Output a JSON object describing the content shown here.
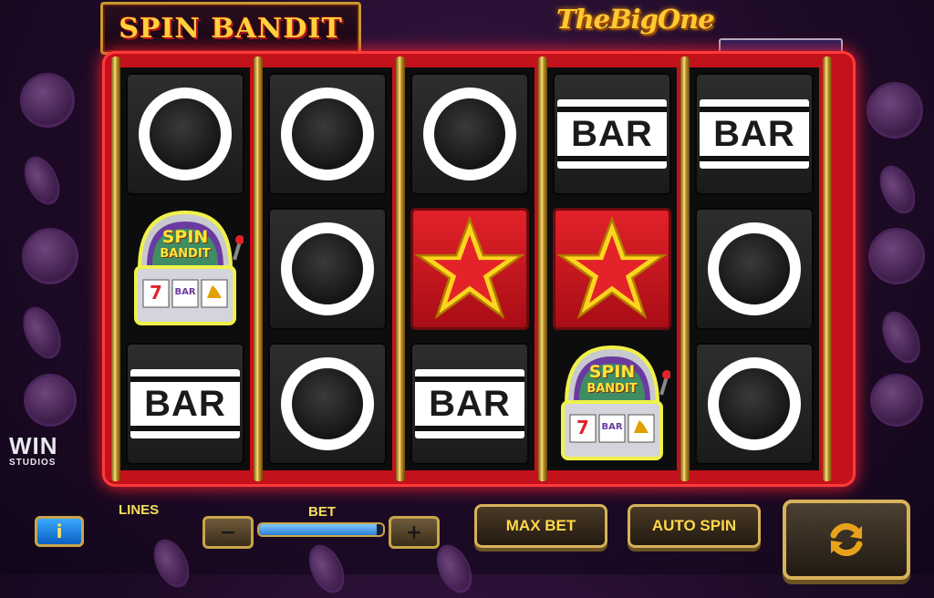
{
  "header": {
    "game_title": "SPIN BANDIT",
    "brand_logo": "TheBigOne",
    "win_display": ""
  },
  "reels": [
    [
      "ring",
      "spin-bandit-machine",
      "bar"
    ],
    [
      "ring",
      "ring",
      "ring"
    ],
    [
      "ring",
      "star",
      "bar"
    ],
    [
      "bar",
      "star",
      "spin-bandit-machine"
    ],
    [
      "bar",
      "ring",
      "ring"
    ]
  ],
  "symbols": {
    "bar_text": "BAR",
    "machine_title_line1": "SPIN",
    "machine_title_line2": "BANDIT",
    "machine_reel_1": "7",
    "machine_reel_2": "BAR",
    "machine_reel_3": "bell"
  },
  "controls": {
    "info_label": "i",
    "lines_label": "LINES",
    "bet_label": "BET",
    "minus_label": "−",
    "plus_label": "+",
    "bet_level": 0.95,
    "max_bet_label": "MAX BET",
    "auto_spin_label": "AUTO SPIN",
    "spin_icon": "refresh-icon"
  },
  "studio": {
    "name": "WIN",
    "sub": "STUDIOS"
  },
  "colors": {
    "frame": "#c3121b",
    "accent_gold": "#ffd23a",
    "star_red": "#e3222a"
  }
}
